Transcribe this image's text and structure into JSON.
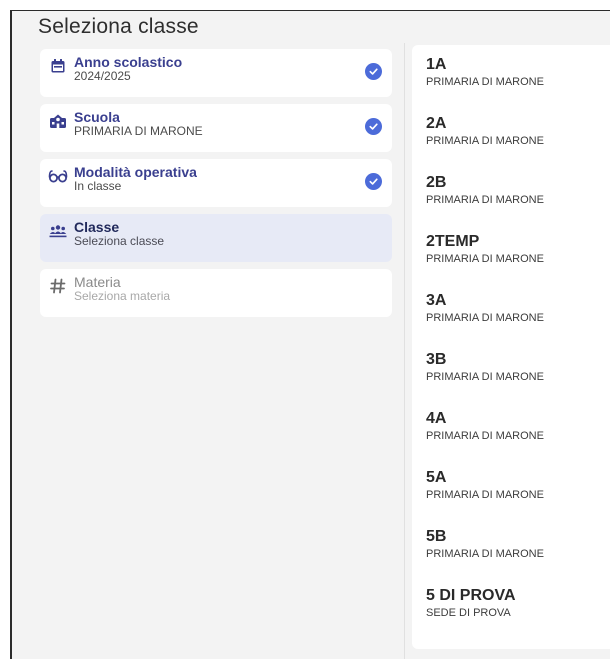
{
  "title": "Seleziona classe",
  "steps": [
    {
      "title": "Anno scolastico",
      "subtitle": "2024/2025",
      "icon": "calendar-icon",
      "state": "done"
    },
    {
      "title": "Scuola",
      "subtitle": "PRIMARIA DI MARONE",
      "icon": "school-icon",
      "state": "done"
    },
    {
      "title": "Modalità operativa",
      "subtitle": "In classe",
      "icon": "glasses-icon",
      "state": "done"
    },
    {
      "title": "Classe",
      "subtitle": "Seleziona classe",
      "icon": "group-icon",
      "state": "active"
    },
    {
      "title": "Materia",
      "subtitle": "Seleziona materia",
      "icon": "hash-icon",
      "state": "disabled"
    }
  ],
  "classes": [
    {
      "name": "1A",
      "school": "PRIMARIA DI MARONE"
    },
    {
      "name": "2A",
      "school": "PRIMARIA DI MARONE"
    },
    {
      "name": "2B",
      "school": "PRIMARIA DI MARONE"
    },
    {
      "name": "2TEMP",
      "school": "PRIMARIA DI MARONE"
    },
    {
      "name": "3A",
      "school": "PRIMARIA DI MARONE"
    },
    {
      "name": "3B",
      "school": "PRIMARIA DI MARONE"
    },
    {
      "name": "4A",
      "school": "PRIMARIA DI MARONE"
    },
    {
      "name": "5A",
      "school": "PRIMARIA DI MARONE"
    },
    {
      "name": "5B",
      "school": "PRIMARIA DI MARONE"
    },
    {
      "name": "5 DI PROVA",
      "school": "SEDE DI PROVA"
    }
  ],
  "colors": {
    "accent": "#3a3f8f",
    "check": "#4c6bd9",
    "active_bg": "#e7eaf6",
    "panel_bg": "#f3f3f3"
  }
}
